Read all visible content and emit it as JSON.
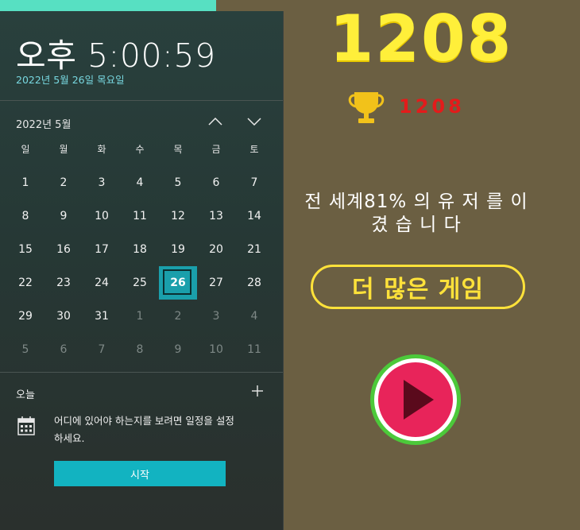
{
  "flyout": {
    "clock": "오후 5:00:59",
    "date_long": "2022년 5월 26일 목요일",
    "month_label": "2022년 5월",
    "weekdays": [
      "일",
      "월",
      "화",
      "수",
      "목",
      "금",
      "토"
    ],
    "weeks": [
      [
        {
          "d": "1"
        },
        {
          "d": "2"
        },
        {
          "d": "3"
        },
        {
          "d": "4"
        },
        {
          "d": "5"
        },
        {
          "d": "6"
        },
        {
          "d": "7"
        }
      ],
      [
        {
          "d": "8"
        },
        {
          "d": "9"
        },
        {
          "d": "10"
        },
        {
          "d": "11"
        },
        {
          "d": "12"
        },
        {
          "d": "13"
        },
        {
          "d": "14"
        }
      ],
      [
        {
          "d": "15"
        },
        {
          "d": "16"
        },
        {
          "d": "17"
        },
        {
          "d": "18"
        },
        {
          "d": "19"
        },
        {
          "d": "20"
        },
        {
          "d": "21"
        }
      ],
      [
        {
          "d": "22"
        },
        {
          "d": "23"
        },
        {
          "d": "24"
        },
        {
          "d": "25"
        },
        {
          "d": "26",
          "today": true
        },
        {
          "d": "27"
        },
        {
          "d": "28"
        }
      ],
      [
        {
          "d": "29"
        },
        {
          "d": "30"
        },
        {
          "d": "31"
        },
        {
          "d": "1",
          "dim": true
        },
        {
          "d": "2",
          "dim": true
        },
        {
          "d": "3",
          "dim": true
        },
        {
          "d": "4",
          "dim": true
        }
      ],
      [
        {
          "d": "5",
          "dim": true
        },
        {
          "d": "6",
          "dim": true
        },
        {
          "d": "7",
          "dim": true
        },
        {
          "d": "8",
          "dim": true
        },
        {
          "d": "9",
          "dim": true
        },
        {
          "d": "10",
          "dim": true
        },
        {
          "d": "11",
          "dim": true
        }
      ]
    ],
    "today_label": "오늘",
    "agenda_message": "어디에 있어야 하는지를 보려면 일정을 설정하세요.",
    "start_button": "시작",
    "icons": {
      "prev": "chevron-up-icon",
      "next": "chevron-down-icon",
      "add": "plus-icon",
      "calendar": "calendar-icon"
    }
  },
  "game": {
    "score": "1208",
    "best_score": "1208",
    "beat_text": "전 세계81% 의 유 저 를 이 겼 습 니 다",
    "more_games": "더 많은 게임",
    "icons": {
      "trophy": "trophy-icon",
      "play": "play-icon"
    },
    "colors": {
      "background": "#6b5f42",
      "score": "#ffef3a",
      "best": "#e31b1b",
      "play": "#e8245a",
      "play_ring": "#4cc93a"
    }
  }
}
